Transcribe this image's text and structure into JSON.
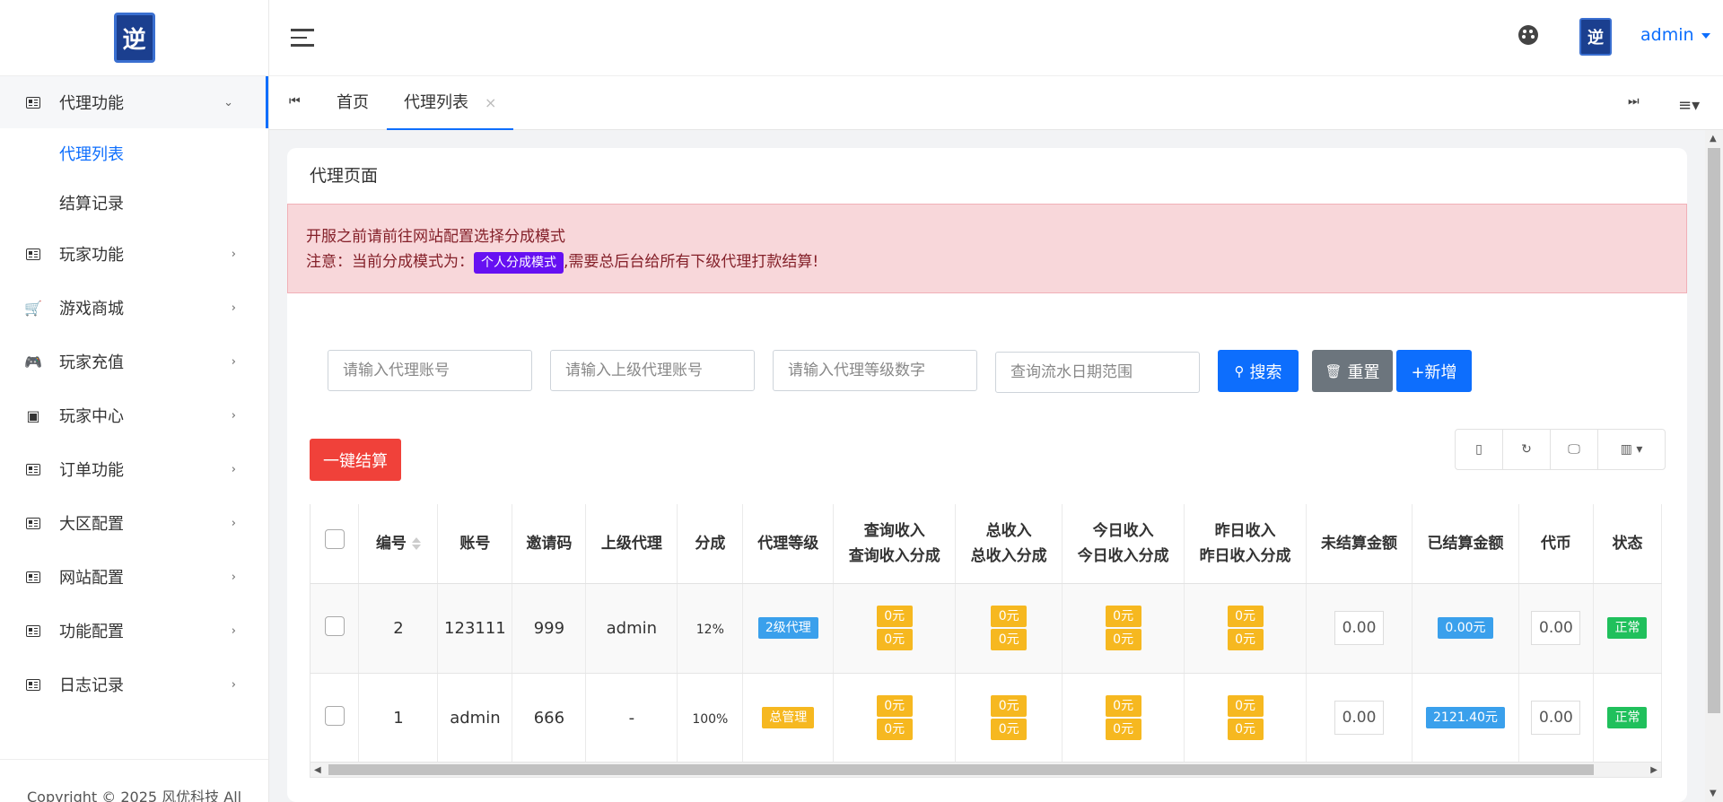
{
  "brand": {
    "logo_text": "逆"
  },
  "sidebar": {
    "items": [
      {
        "label": "代理功能",
        "expanded": true,
        "sub": [
          {
            "label": "代理列表",
            "active": true
          },
          {
            "label": "结算记录",
            "active": false
          }
        ]
      },
      {
        "label": "玩家功能"
      },
      {
        "label": "游戏商城"
      },
      {
        "label": "玩家充值"
      },
      {
        "label": "玩家中心"
      },
      {
        "label": "订单功能"
      },
      {
        "label": "大区配置"
      },
      {
        "label": "网站配置"
      },
      {
        "label": "功能配置"
      },
      {
        "label": "日志记录"
      }
    ],
    "footer": "Copyright © 2025 风优科技 All"
  },
  "header": {
    "user": "admin",
    "avatar_text": "逆"
  },
  "tabs": {
    "items": [
      {
        "label": "首页"
      },
      {
        "label": "代理列表",
        "close": "×"
      }
    ],
    "prev": "⏮",
    "next": "⏭",
    "menu": "≡▾"
  },
  "page": {
    "title": "代理页面",
    "alert": {
      "line1": "开服之前请前往网站配置选择分成模式",
      "line2_prefix": "注意：当前分成模式为：",
      "mode": "个人分成模式",
      "line2_suffix": ",需要总后台给所有下级代理打款结算!"
    },
    "search": {
      "account_placeholder": "请输入代理账号",
      "parent_placeholder": "请输入上级代理账号",
      "level_placeholder": "请输入代理等级数字",
      "date_placeholder": "查询流水日期范围",
      "search_btn": "搜索",
      "reset_btn": "重置",
      "add_btn": "+新增"
    },
    "settle_btn": "一键结算"
  },
  "table": {
    "columns": {
      "id": "编号",
      "account": "账号",
      "invite": "邀请码",
      "parent": "上级代理",
      "share": "分成",
      "level": "代理等级",
      "query_a": "查询收入",
      "query_b": "查询收入分成",
      "total_a": "总收入",
      "total_b": "总收入分成",
      "today_a": "今日收入",
      "today_b": "今日收入分成",
      "yest_a": "昨日收入",
      "yest_b": "昨日收入分成",
      "unsettled": "未结算金额",
      "settled": "已结算金额",
      "coin": "代币",
      "status": "状态"
    },
    "rows": [
      {
        "id": "2",
        "account": "123111",
        "invite": "999",
        "parent": "admin",
        "share": "12%",
        "level": "2级代理",
        "level_color": "#3aa0ec",
        "q1": "0元",
        "q2": "0元",
        "t1": "0元",
        "t2": "0元",
        "d1": "0元",
        "d2": "0元",
        "y1": "0元",
        "y2": "0元",
        "unsettled": "0.00",
        "settled": "0.00元",
        "coin": "0.00",
        "status": "正常"
      },
      {
        "id": "1",
        "account": "admin",
        "invite": "666",
        "parent": "-",
        "share": "100%",
        "level": "总管理",
        "level_color": "#f6b820",
        "q1": "0元",
        "q2": "0元",
        "t1": "0元",
        "t2": "0元",
        "d1": "0元",
        "d2": "0元",
        "y1": "0元",
        "y2": "0元",
        "unsettled": "0.00",
        "settled": "2121.40元",
        "coin": "0.00",
        "status": "正常"
      }
    ]
  },
  "colors": {
    "primary": "#0d6efd",
    "danger": "#f0413a",
    "alert_bg": "#f8d7da",
    "purple": "#6610f2"
  }
}
